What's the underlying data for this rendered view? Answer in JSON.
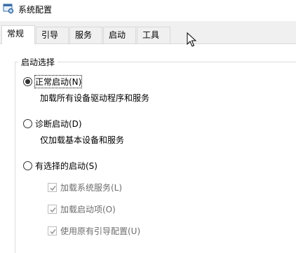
{
  "window": {
    "title": "系统配置"
  },
  "tabs": [
    {
      "label": "常规",
      "active": true
    },
    {
      "label": "引导",
      "active": false
    },
    {
      "label": "服务",
      "active": false
    },
    {
      "label": "启动",
      "active": false
    },
    {
      "label": "工具",
      "active": false
    }
  ],
  "startup_group": {
    "legend": "启动选择",
    "normal": {
      "label": "正常启动(N)",
      "desc": "加载所有设备驱动程序和服务",
      "selected": true
    },
    "diagnostic": {
      "label": "诊断启动(D)",
      "desc": "仅加载基本设备和服务",
      "selected": false
    },
    "selective": {
      "label": "有选择的启动(S)",
      "selected": false,
      "options": [
        {
          "label": "加载系统服务(L)",
          "checked": true
        },
        {
          "label": "加载启动项(O)",
          "checked": true
        },
        {
          "label": "使用原有引导配置(U)",
          "checked": true
        }
      ]
    }
  },
  "icons": {
    "app": "system-config-icon",
    "cursor": "mouse-pointer-icon"
  },
  "colors": {
    "tab_bar": "#f0f0f0",
    "border": "#d9d9d9",
    "disabled_text": "#6d6d6d"
  }
}
